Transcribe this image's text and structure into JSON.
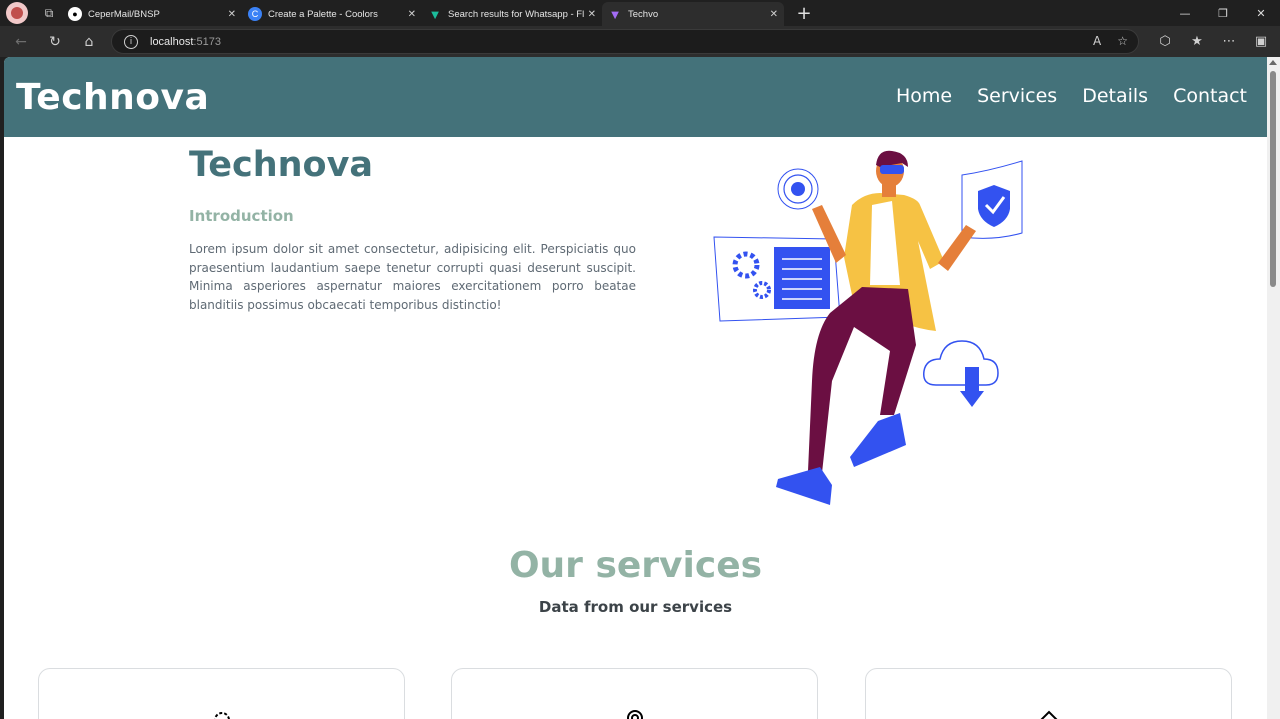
{
  "browser": {
    "tabs": [
      {
        "title": "CeperMail/BNSP",
        "icon": "github-icon"
      },
      {
        "title": "Create a Palette - Coolors",
        "icon": "coolors-icon"
      },
      {
        "title": "Search results for Whatsapp - Fla",
        "icon": "flaticon-icon"
      },
      {
        "title": "Techvo",
        "icon": "vite-icon"
      }
    ],
    "url_host": "localhost",
    "url_port": ":5173"
  },
  "site": {
    "logo": "Technova",
    "nav": [
      "Home",
      "Services",
      "Details",
      "Contact"
    ]
  },
  "hero": {
    "title": "Technova",
    "subtitle": "Introduction",
    "text": "Lorem ipsum dolor sit amet consectetur, adipisicing elit. Perspiciatis quo praesentium laudantium saepe tenetur corrupti quasi deserunt suscipit. Minima asperiores aspernatur maiores exercitationem porro beatae blanditiis possimus obcaecati temporibus distinctio!"
  },
  "services": {
    "title": "Our services",
    "subtitle": "Data from our services",
    "cards": [
      {
        "icon": "gear-icon"
      },
      {
        "icon": "location-icon"
      },
      {
        "icon": "home-icon"
      }
    ]
  },
  "colors": {
    "header": "#44727a",
    "accent_light": "#93b3a5",
    "illustration_blue": "#3352f0"
  }
}
